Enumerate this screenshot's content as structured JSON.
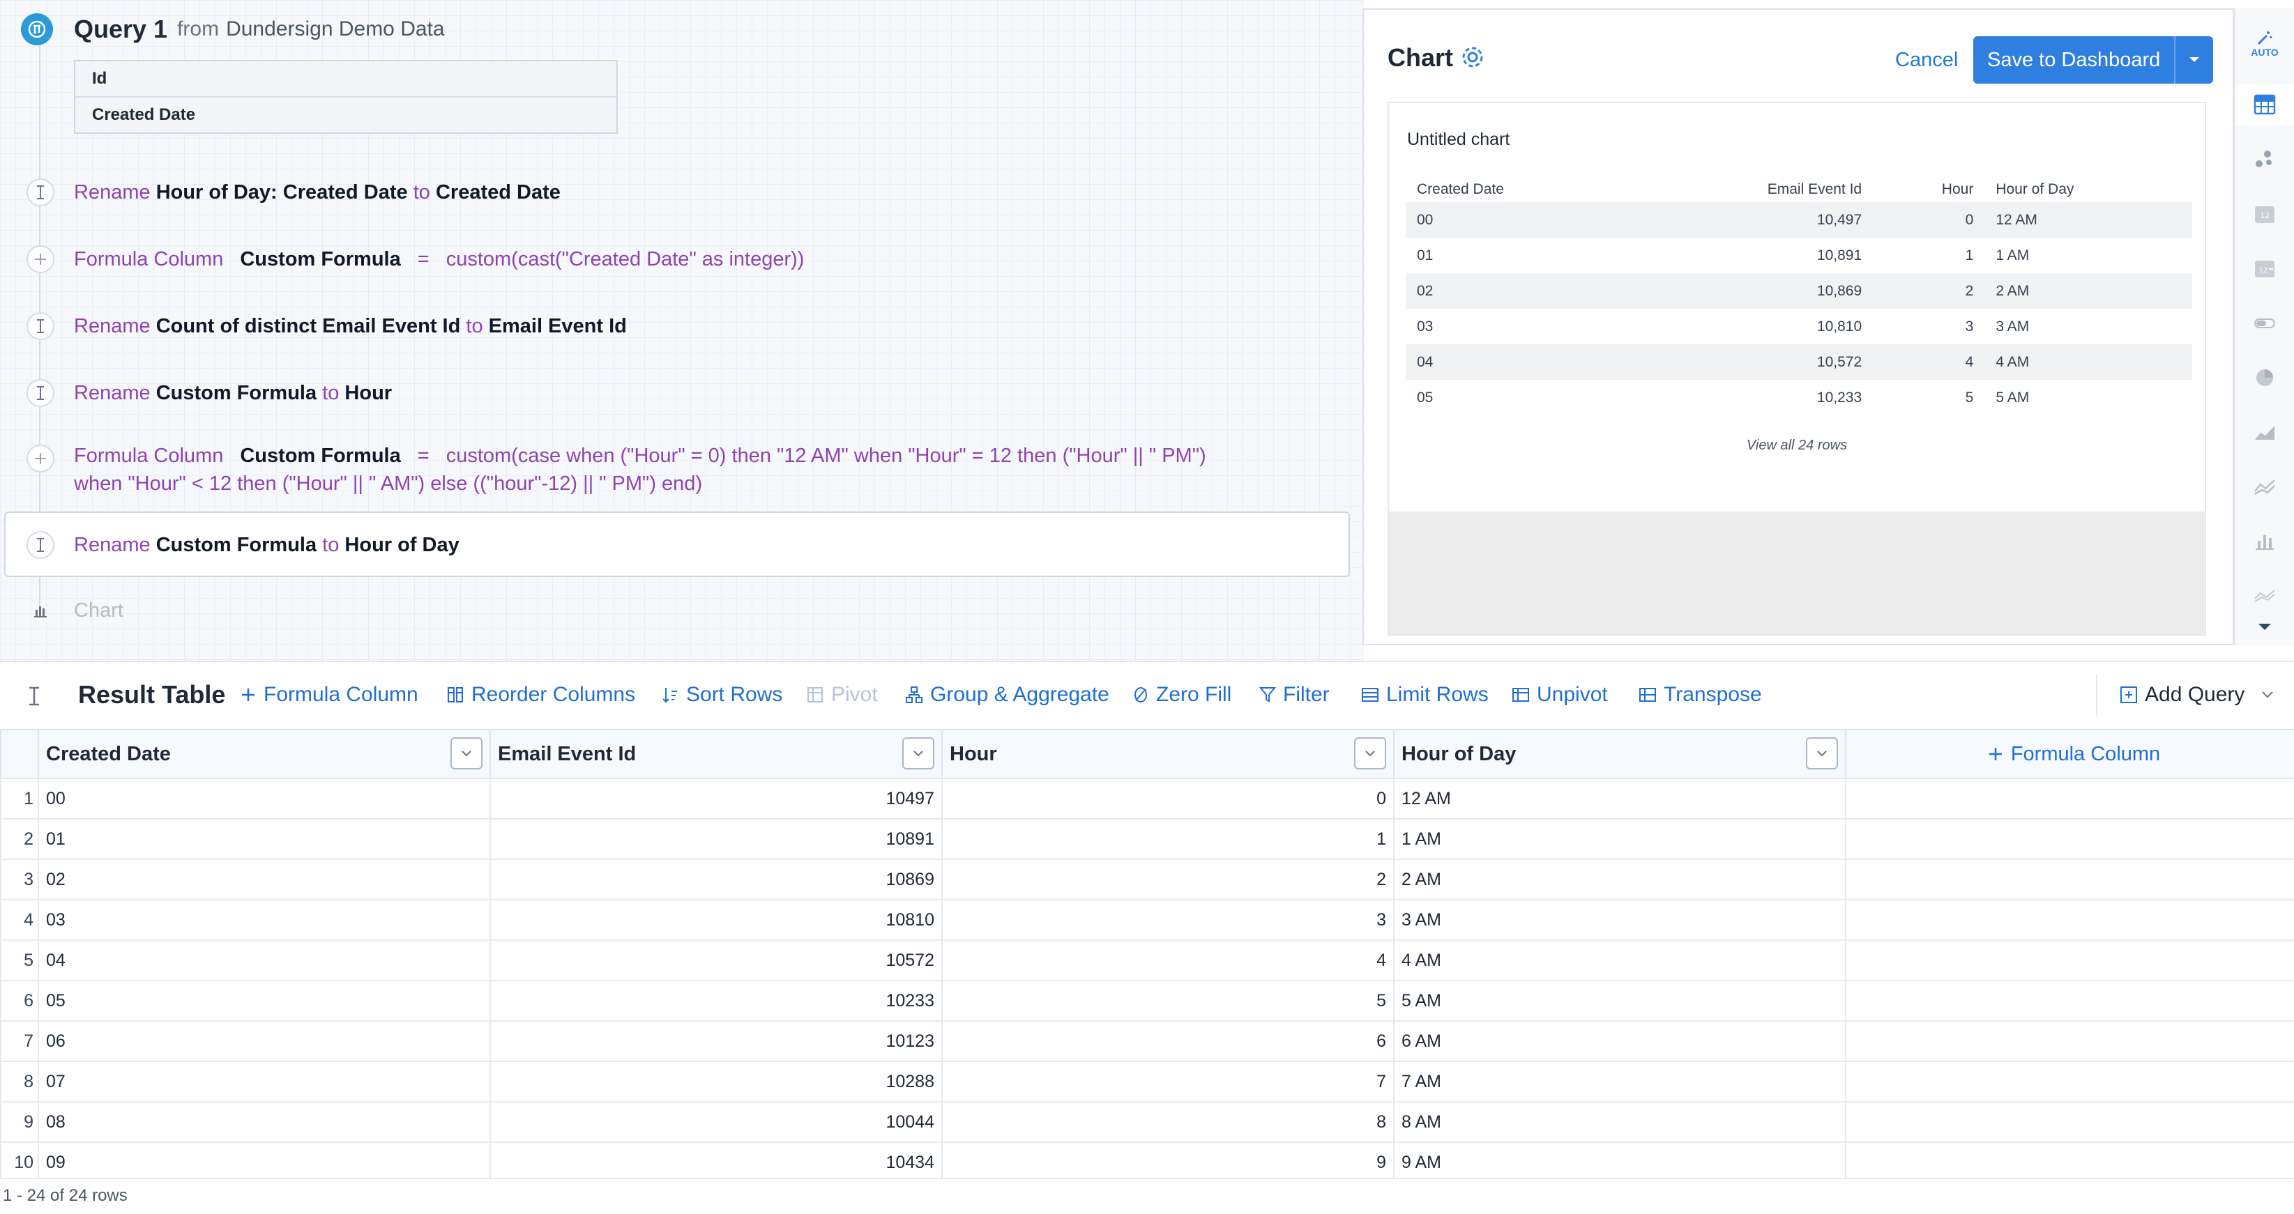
{
  "query": {
    "title": "Query 1",
    "from_label": "from",
    "source": "Dundersign Demo Data",
    "columns": [
      "Id",
      "Created Date"
    ]
  },
  "steps": {
    "s1": {
      "kw1": "Rename",
      "subject": "Hour of Day: Created Date",
      "kw2": "to",
      "target": "Created Date"
    },
    "s2": {
      "kw1": "Formula Column",
      "name": "Custom Formula",
      "eq": "=",
      "formula": "custom(cast(\"Created Date\" as integer))"
    },
    "s3": {
      "kw1": "Rename",
      "subject": "Count of distinct Email Event Id",
      "kw2": "to",
      "target": "Email Event Id"
    },
    "s4": {
      "kw1": "Rename",
      "subject": "Custom Formula",
      "kw2": "to",
      "target": "Hour"
    },
    "s5": {
      "kw1": "Formula Column",
      "name": "Custom Formula",
      "eq": "=",
      "formula_line1": "custom(case when (\"Hour\" = 0) then \"12 AM\" when \"Hour\" = 12 then (\"Hour\" || \" PM\")",
      "formula_line2": "when \"Hour\" < 12 then (\"Hour\" || \" AM\") else ((\"hour\"-12) || \" PM\") end)"
    },
    "s6": {
      "kw1": "Rename",
      "subject": "Custom Formula",
      "kw2": "to",
      "target": "Hour of Day"
    },
    "chart_step": "Chart"
  },
  "chart_panel": {
    "title": "Chart",
    "cancel": "Cancel",
    "save": "Save to Dashboard",
    "preview_title": "Untitled chart",
    "headers": [
      "Created Date",
      "Email Event Id",
      "Hour",
      "Hour of Day"
    ],
    "rows": [
      [
        "00",
        "10,497",
        "0",
        "12 AM"
      ],
      [
        "01",
        "10,891",
        "1",
        "1 AM"
      ],
      [
        "02",
        "10,869",
        "2",
        "2 AM"
      ],
      [
        "03",
        "10,810",
        "3",
        "3 AM"
      ],
      [
        "04",
        "10,572",
        "4",
        "4 AM"
      ],
      [
        "05",
        "10,233",
        "5",
        "5 AM"
      ]
    ],
    "view_all": "View all 24 rows",
    "auto_label": "AUTO"
  },
  "toolbar": {
    "title": "Result Table",
    "formula_column": "Formula Column",
    "reorder_columns": "Reorder Columns",
    "sort_rows": "Sort Rows",
    "pivot": "Pivot",
    "group_aggregate": "Group & Aggregate",
    "zero_fill": "Zero Fill",
    "filter": "Filter",
    "limit_rows": "Limit Rows",
    "unpivot": "Unpivot",
    "transpose": "Transpose",
    "add_query": "Add Query"
  },
  "result": {
    "headers": [
      "Created Date",
      "Email Event Id",
      "Hour",
      "Hour of Day"
    ],
    "add_column": "Formula Column",
    "rows": [
      [
        "1",
        "00",
        "10497",
        "0",
        "12 AM"
      ],
      [
        "2",
        "01",
        "10891",
        "1",
        "1 AM"
      ],
      [
        "3",
        "02",
        "10869",
        "2",
        "2 AM"
      ],
      [
        "4",
        "03",
        "10810",
        "3",
        "3 AM"
      ],
      [
        "5",
        "04",
        "10572",
        "4",
        "4 AM"
      ],
      [
        "6",
        "05",
        "10233",
        "5",
        "5 AM"
      ],
      [
        "7",
        "06",
        "10123",
        "6",
        "6 AM"
      ],
      [
        "8",
        "07",
        "10288",
        "7",
        "7 AM"
      ],
      [
        "9",
        "08",
        "10044",
        "8",
        "8 AM"
      ],
      [
        "10",
        "09",
        "10434",
        "9",
        "9 AM"
      ]
    ],
    "footer": "1 - 24 of 24 rows"
  },
  "colors": {
    "accent": "#2f7fe0",
    "keyword": "#8e44ad",
    "link": "#1f6fd0"
  }
}
